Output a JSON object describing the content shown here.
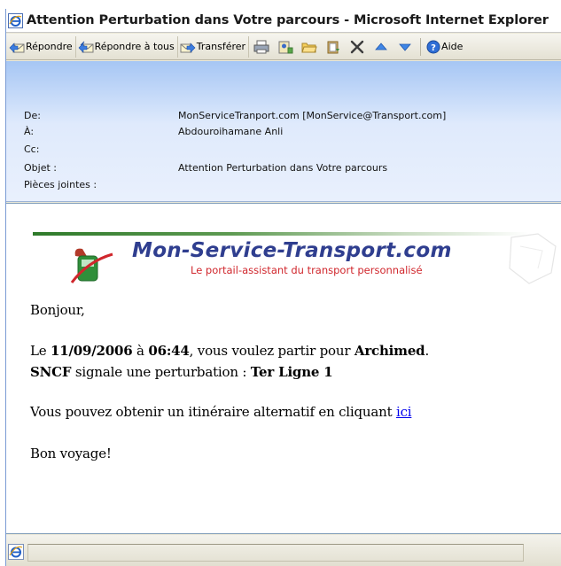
{
  "window": {
    "title": "Attention Perturbation dans Votre parcours - Microsoft Internet Explorer"
  },
  "toolbar": {
    "reply_label": "Répondre",
    "reply_all_label": "Répondre à tous",
    "forward_label": "Transférer",
    "help_label": "Aide"
  },
  "header": {
    "from_label": "De:",
    "from_value": "MonServiceTranport.com [MonService@Transport.com]",
    "to_label": "À:",
    "to_value": "Abdouroihamane Anli",
    "cc_label": "Cc:",
    "subject_label": "Objet :",
    "subject_value": "Attention Perturbation dans Votre parcours",
    "attachments_label": "Pièces jointes :"
  },
  "banner": {
    "brand": "Mon-Service-Transport.com",
    "tagline": "Le portail-assistant du transport personnalisé"
  },
  "message": {
    "greeting": "Bonjour,",
    "line1_prefix": "Le ",
    "date": "11/09/2006",
    "line1_mid": " à ",
    "time": "06:44",
    "line1_mid2": ", vous voulez partir pour ",
    "destination": "Archimed",
    "line1_end": ".",
    "operator": "SNCF",
    "line2_mid": " signale une perturbation : ",
    "line_name": "Ter Ligne 1",
    "alt_text": "Vous pouvez obtenir un itinéraire alternatif en cliquant ",
    "alt_link": "ici",
    "closing": "Bon voyage!"
  },
  "colors": {
    "header_gradient_top": "#a6c6f4",
    "brand_blue": "#2f3e8f",
    "brand_red": "#d0262c",
    "link_blue": "#0000ee"
  }
}
